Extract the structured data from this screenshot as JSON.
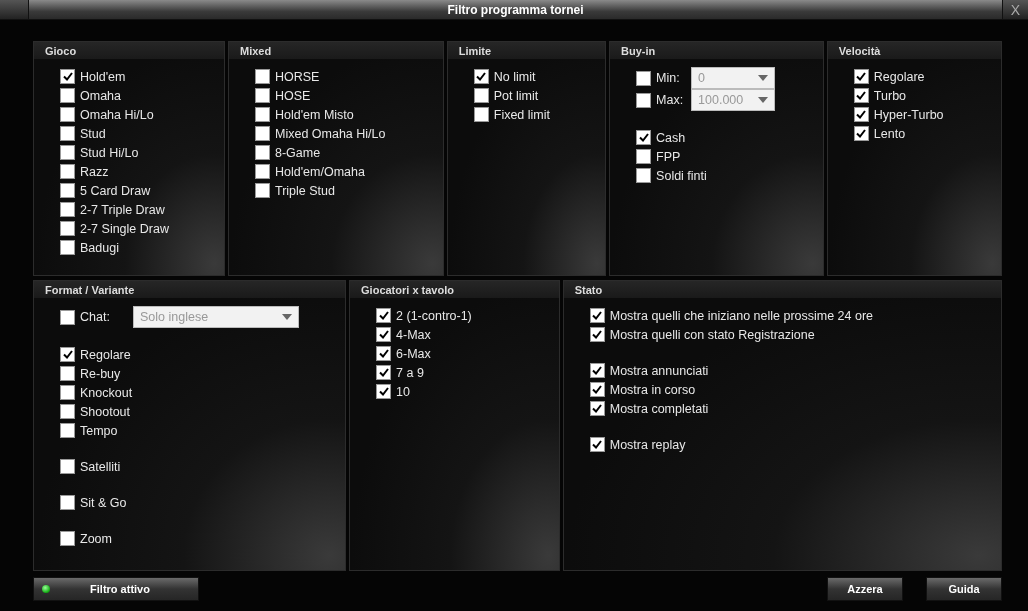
{
  "window": {
    "title": "Filtro programma tornei",
    "close": "X"
  },
  "top_panels": [
    {
      "title": "Gioco",
      "groups": [
        [
          {
            "kind": "check",
            "label": "Hold'em",
            "checked": true
          },
          {
            "kind": "check",
            "label": "Omaha",
            "checked": false
          },
          {
            "kind": "check",
            "label": "Omaha Hi/Lo",
            "checked": false
          },
          {
            "kind": "check",
            "label": "Stud",
            "checked": false
          },
          {
            "kind": "check",
            "label": "Stud Hi/Lo",
            "checked": false
          },
          {
            "kind": "check",
            "label": "Razz",
            "checked": false
          },
          {
            "kind": "check",
            "label": "5 Card Draw",
            "checked": false
          },
          {
            "kind": "check",
            "label": "2-7 Triple Draw",
            "checked": false
          },
          {
            "kind": "check",
            "label": "2-7 Single Draw",
            "checked": false
          },
          {
            "kind": "check",
            "label": "Badugi",
            "checked": false
          }
        ]
      ]
    },
    {
      "title": "Mixed",
      "groups": [
        [
          {
            "kind": "check",
            "label": "HORSE",
            "checked": false
          },
          {
            "kind": "check",
            "label": "HOSE",
            "checked": false
          },
          {
            "kind": "check",
            "label": "Hold'em Misto",
            "checked": false
          },
          {
            "kind": "check",
            "label": "Mixed Omaha Hi/Lo",
            "checked": false
          },
          {
            "kind": "check",
            "label": "8-Game",
            "checked": false
          },
          {
            "kind": "check",
            "label": "Hold'em/Omaha",
            "checked": false
          },
          {
            "kind": "check",
            "label": "Triple Stud",
            "checked": false
          }
        ]
      ]
    },
    {
      "title": "Limite",
      "groups": [
        [
          {
            "kind": "check",
            "label": "No limit",
            "checked": true
          },
          {
            "kind": "check",
            "label": "Pot limit",
            "checked": false
          },
          {
            "kind": "check",
            "label": "Fixed limit",
            "checked": false
          }
        ]
      ]
    },
    {
      "title": "Buy-in",
      "groups": [
        [
          {
            "kind": "select",
            "label": "Min:",
            "checked": false,
            "value": "0"
          },
          {
            "kind": "select",
            "label": "Max:",
            "checked": false,
            "value": "100.000"
          }
        ],
        [
          {
            "kind": "check",
            "label": "Cash",
            "checked": true
          },
          {
            "kind": "check",
            "label": "FPP",
            "checked": false
          },
          {
            "kind": "check",
            "label": "Soldi finti",
            "checked": false
          }
        ]
      ]
    },
    {
      "title": "Velocità",
      "groups": [
        [
          {
            "kind": "check",
            "label": "Regolare",
            "checked": true
          },
          {
            "kind": "check",
            "label": "Turbo",
            "checked": true
          },
          {
            "kind": "check",
            "label": "Hyper-Turbo",
            "checked": true
          },
          {
            "kind": "check",
            "label": "Lento",
            "checked": true
          }
        ]
      ]
    }
  ],
  "bottom_panels": [
    {
      "title": "Format / Variante",
      "groups": [
        [
          {
            "kind": "select",
            "label": "Chat:",
            "checked": false,
            "value": "Solo inglese"
          }
        ],
        [
          {
            "kind": "check",
            "label": "Regolare",
            "checked": true
          },
          {
            "kind": "check",
            "label": "Re-buy",
            "checked": false
          },
          {
            "kind": "check",
            "label": "Knockout",
            "checked": false
          },
          {
            "kind": "check",
            "label": "Shootout",
            "checked": false
          },
          {
            "kind": "check",
            "label": "Tempo",
            "checked": false
          }
        ],
        [
          {
            "kind": "check",
            "label": "Satelliti",
            "checked": false
          }
        ],
        [
          {
            "kind": "check",
            "label": "Sit & Go",
            "checked": false
          }
        ],
        [
          {
            "kind": "check",
            "label": "Zoom",
            "checked": false
          }
        ]
      ]
    },
    {
      "title": "Giocatori x tavolo",
      "groups": [
        [
          {
            "kind": "check",
            "label": "2 (1-contro-1)",
            "checked": true
          },
          {
            "kind": "check",
            "label": "4-Max",
            "checked": true
          },
          {
            "kind": "check",
            "label": "6-Max",
            "checked": true
          },
          {
            "kind": "check",
            "label": "7 a 9",
            "checked": true
          },
          {
            "kind": "check",
            "label": "10",
            "checked": true
          }
        ]
      ]
    },
    {
      "title": "Stato",
      "groups": [
        [
          {
            "kind": "check",
            "label": "Mostra quelli che iniziano nelle prossime 24 ore",
            "checked": true
          },
          {
            "kind": "check",
            "label": "Mostra quelli con stato Registrazione",
            "checked": true
          }
        ],
        [
          {
            "kind": "check",
            "label": "Mostra annunciati",
            "checked": true
          },
          {
            "kind": "check",
            "label": "Mostra in corso",
            "checked": true
          },
          {
            "kind": "check",
            "label": "Mostra completati",
            "checked": true
          }
        ],
        [
          {
            "kind": "check",
            "label": "Mostra replay",
            "checked": true
          }
        ]
      ]
    }
  ],
  "footer": {
    "filter_button": {
      "label": "Filtro attivo",
      "active": true
    },
    "buttons": [
      "Azzera",
      "Guida"
    ]
  }
}
